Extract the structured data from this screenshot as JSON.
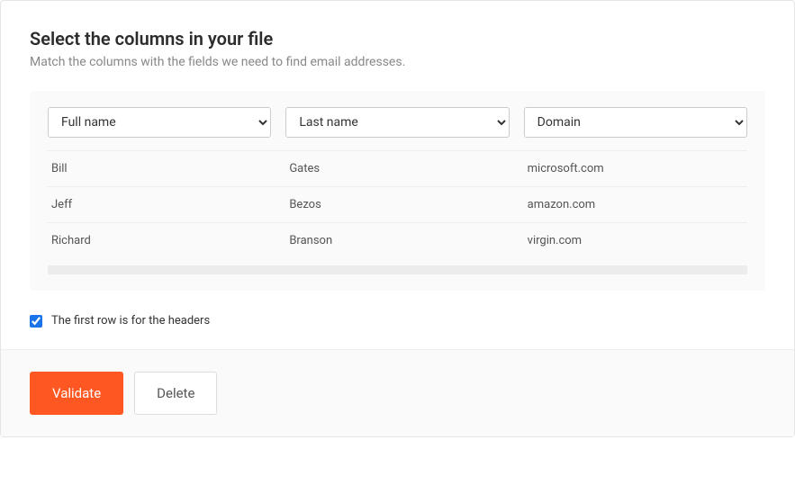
{
  "title": "Select the columns in your file",
  "subtitle": "Match the columns with the fields we need to find email addresses.",
  "columns": {
    "selected": [
      "Full name",
      "Last name",
      "Domain"
    ]
  },
  "rows": [
    {
      "c0": "Bill",
      "c1": "Gates",
      "c2": "microsoft.com"
    },
    {
      "c0": "Jeff",
      "c1": "Bezos",
      "c2": "amazon.com"
    },
    {
      "c0": "Richard",
      "c1": "Branson",
      "c2": "virgin.com"
    }
  ],
  "first_row_header": {
    "label": "The first row is for the headers",
    "checked": true
  },
  "footer": {
    "validate": "Validate",
    "delete": "Delete"
  }
}
